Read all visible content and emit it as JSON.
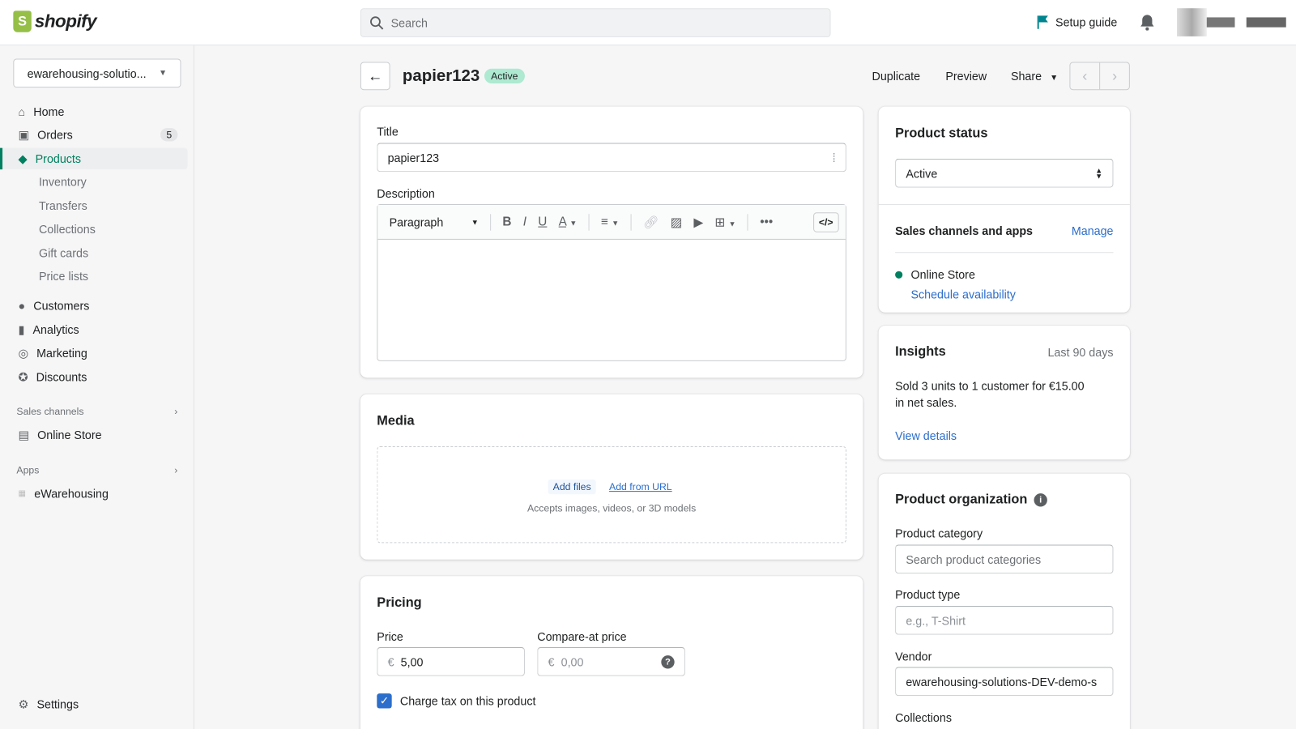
{
  "topbar": {
    "brand": "shopify",
    "search_placeholder": "Search",
    "setup_guide": "Setup guide"
  },
  "sidebar": {
    "store": "ewarehousing-solutio...",
    "items": [
      {
        "label": "Home",
        "icon": "home-icon"
      },
      {
        "label": "Orders",
        "icon": "orders-icon",
        "badge": "5"
      },
      {
        "label": "Products",
        "icon": "tag-icon"
      }
    ],
    "sub": [
      "Inventory",
      "Transfers",
      "Collections",
      "Gift cards",
      "Price lists"
    ],
    "items2": [
      {
        "label": "Customers",
        "icon": "person-icon"
      },
      {
        "label": "Analytics",
        "icon": "bar-chart-icon"
      },
      {
        "label": "Marketing",
        "icon": "target-icon"
      },
      {
        "label": "Discounts",
        "icon": "discount-icon"
      }
    ],
    "sales_channels": "Sales channels",
    "online_store": "Online Store",
    "apps": "Apps",
    "ewarehousing": "eWarehousing",
    "settings": "Settings"
  },
  "header": {
    "title": "papier123",
    "status": "Active",
    "duplicate": "Duplicate",
    "preview": "Preview",
    "share": "Share"
  },
  "main": {
    "title_label": "Title",
    "title_value": "papier123",
    "description_label": "Description",
    "toolbar": {
      "paragraph": "Paragraph"
    },
    "media": {
      "heading": "Media",
      "add_files": "Add files",
      "add_url": "Add from URL",
      "hint": "Accepts images, videos, or 3D models"
    },
    "pricing": {
      "heading": "Pricing",
      "price_label": "Price",
      "currency": "€",
      "price": "5,00",
      "compare_label": "Compare-at price",
      "compare_placeholder": "0,00",
      "charge_tax": "Charge tax on this product",
      "charge_tax_checked": true
    }
  },
  "right": {
    "status": {
      "heading": "Product status",
      "value": "Active",
      "sales_channels": "Sales channels and apps",
      "manage": "Manage",
      "channel": "Online Store",
      "schedule": "Schedule availability"
    },
    "insights": {
      "heading": "Insights",
      "period": "Last 90 days",
      "text1": "Sold 3 units to 1 customer for €15.00",
      "text2": "in net sales.",
      "link": "View details"
    },
    "org": {
      "heading": "Product organization",
      "category_label": "Product category",
      "category_placeholder": "Search product categories",
      "type_label": "Product type",
      "type_placeholder": "e.g., T-Shirt",
      "vendor_label": "Vendor",
      "vendor_value": "ewarehousing-solutions-DEV-demo-s",
      "collections_label": "Collections"
    }
  },
  "colors": {
    "accent": "#008060",
    "link": "#2c6ecb",
    "active_badge": "#aee9d1",
    "logo": "#95bf47"
  }
}
